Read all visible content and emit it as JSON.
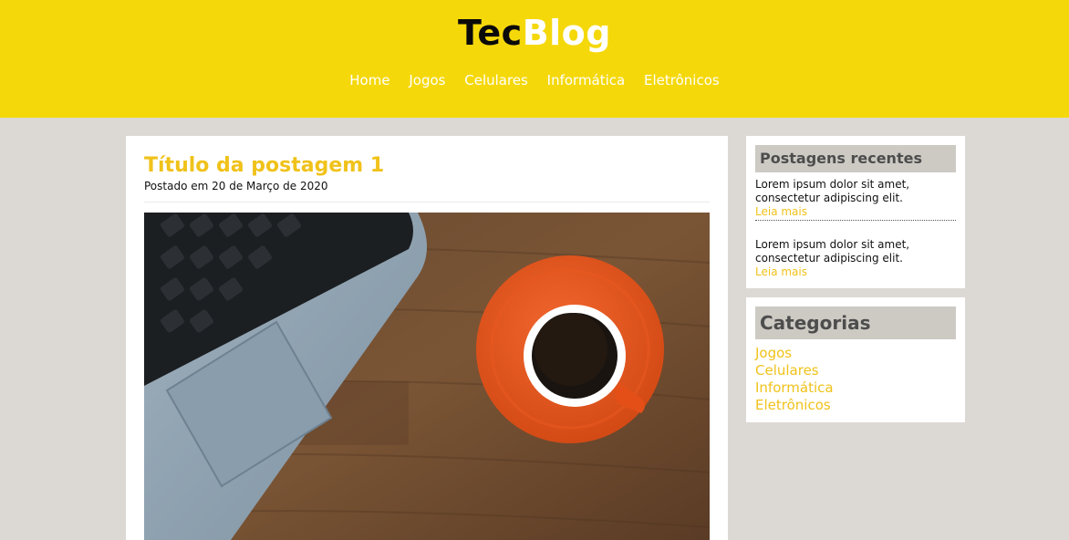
{
  "brand": {
    "part1": "Tec",
    "part2": "Blog"
  },
  "nav": {
    "items": [
      {
        "label": "Home"
      },
      {
        "label": "Jogos"
      },
      {
        "label": "Celulares"
      },
      {
        "label": "Informática"
      },
      {
        "label": "Eletrônicos"
      }
    ]
  },
  "post": {
    "title": "Título da postagem 1",
    "meta": "Postado em 20 de Março de 2020",
    "image_icon": "laptop-coffee-photo"
  },
  "recent": {
    "title": "Postagens recentes",
    "items": [
      {
        "text": "Lorem ipsum dolor sit amet, consectetur adipiscing elit.",
        "link": "Leia mais"
      },
      {
        "text": "Lorem ipsum dolor sit amet, consectetur adipiscing elit.",
        "link": "Leia mais"
      }
    ]
  },
  "categories": {
    "title": "Categorias",
    "items": [
      {
        "label": "Jogos"
      },
      {
        "label": "Celulares"
      },
      {
        "label": "Informática"
      },
      {
        "label": "Eletrônicos"
      }
    ]
  },
  "colors": {
    "header": "#f5d80a",
    "accent": "#f0c21a",
    "background": "#dcd9d4",
    "widget_title_bg": "#cdcac4"
  }
}
